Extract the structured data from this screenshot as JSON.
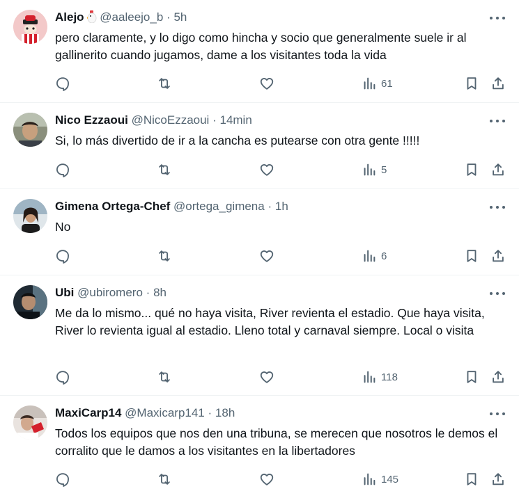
{
  "tweets": [
    {
      "name": "Alejo",
      "handle": "@aaleejo_b",
      "dot": "·",
      "time": "5h",
      "text": "pero claramente, y lo digo como hincha y socio que generalmente suele ir al gallinerito cuando jugamos, dame a los visitantes toda la vida",
      "views": "61",
      "avatar_icon": "red-white-mascot-avatar"
    },
    {
      "name": "Nico Ezzaoui",
      "handle": "@NicoEzzaoui",
      "dot": "·",
      "time": "14min",
      "text": "Si, lo más divertido de ir a la cancha es putearse con otra gente !!!!!",
      "views": "5",
      "avatar_icon": "person-photo-avatar"
    },
    {
      "name": "Gimena Ortega-Chef",
      "handle": "@ortega_gimena",
      "dot": "·",
      "time": "1h",
      "text": "No",
      "views": "6",
      "avatar_icon": "person-photo-avatar"
    },
    {
      "name": "Ubi",
      "handle": "@ubiromero",
      "dot": "·",
      "time": "8h",
      "text": "Me da lo mismo... qué no haya visita, River revienta el estadio. Que haya visita, River lo revienta igual al estadio. Lleno total y carnaval siempre. Local o visita",
      "views": "118",
      "avatar_icon": "person-photo-avatar"
    },
    {
      "name": "MaxiCarp14",
      "handle": "@Maxicarp141",
      "dot": "·",
      "time": "18h",
      "text": "Todos los equipos que nos den una tribuna, se merecen que nosotros le demos el corralito que le damos a los visitantes en la libertadores",
      "views": "145",
      "avatar_icon": "person-photo-avatar"
    }
  ],
  "colors": {
    "text": "#0f1419",
    "muted": "#536471",
    "divider": "#eff3f4"
  },
  "icons": [
    "reply-icon",
    "retweet-icon",
    "like-icon",
    "views-icon",
    "bookmark-icon",
    "share-icon",
    "more-icon"
  ]
}
